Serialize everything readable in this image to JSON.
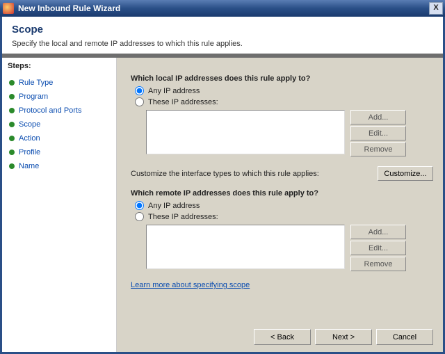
{
  "title": "New Inbound Rule Wizard",
  "close_label": "X",
  "header": {
    "heading": "Scope",
    "description": "Specify the local and remote IP addresses to which this rule applies."
  },
  "steps": {
    "title": "Steps:",
    "items": [
      {
        "label": "Rule Type"
      },
      {
        "label": "Program"
      },
      {
        "label": "Protocol and Ports"
      },
      {
        "label": "Scope"
      },
      {
        "label": "Action"
      },
      {
        "label": "Profile"
      },
      {
        "label": "Name"
      }
    ]
  },
  "main": {
    "local": {
      "question": "Which local IP addresses does this rule apply to?",
      "any_label": "Any IP address",
      "these_label": "These IP addresses:",
      "add": "Add...",
      "edit": "Edit...",
      "remove": "Remove",
      "selected": "any"
    },
    "customize": {
      "text": "Customize the interface types to which this rule applies:",
      "button": "Customize..."
    },
    "remote": {
      "question": "Which remote IP addresses does this rule apply to?",
      "any_label": "Any IP address",
      "these_label": "These IP addresses:",
      "add": "Add...",
      "edit": "Edit...",
      "remove": "Remove",
      "selected": "any"
    },
    "learn_link": "Learn more about specifying scope"
  },
  "footer": {
    "back": "< Back",
    "next": "Next >",
    "cancel": "Cancel"
  }
}
